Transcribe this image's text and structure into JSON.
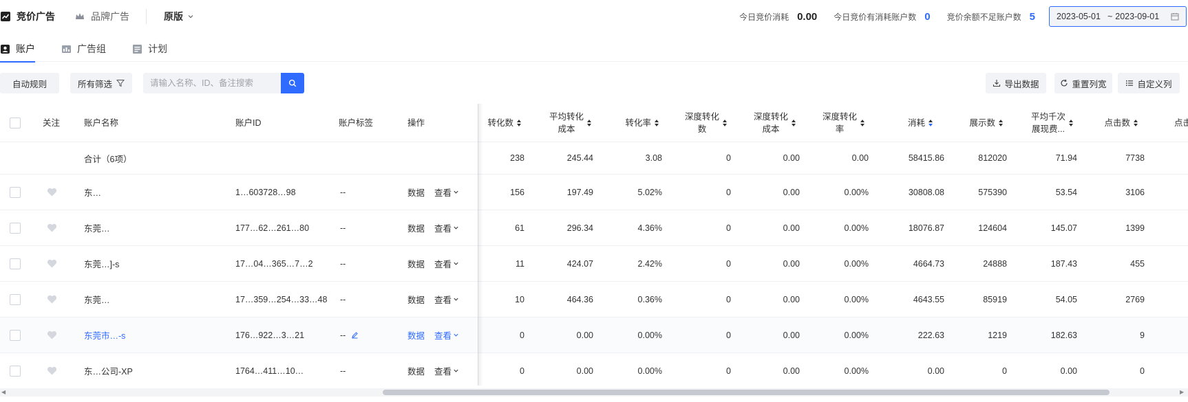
{
  "topbar": {
    "nav": [
      {
        "label": "竞价广告",
        "icon": "trend-chart-icon",
        "active": true
      },
      {
        "label": "品牌广告",
        "icon": "crown-icon",
        "active": false
      }
    ],
    "version": "原版",
    "stats": [
      {
        "label": "今日竞价消耗",
        "value": "0.00",
        "color": "#222222"
      },
      {
        "label": "今日竞价有消耗账户数",
        "value": "0",
        "color": "#2f6bff"
      },
      {
        "label": "竞价余额不足账户数",
        "value": "5",
        "color": "#2f6bff"
      }
    ],
    "date_start": "2023-05-01",
    "date_sep": "~",
    "date_end": "2023-09-01"
  },
  "tabs": [
    {
      "label": "账户",
      "icon": "account-icon",
      "active": true
    },
    {
      "label": "广告组",
      "icon": "ad-group-icon",
      "active": false
    },
    {
      "label": "计划",
      "icon": "plan-icon",
      "active": false
    }
  ],
  "toolbar": {
    "auto_rule": "自动规则",
    "all_filter": "所有筛选",
    "search_placeholder": "请输入名称、ID、备注搜索",
    "export": "导出数据",
    "reset_width": "重置列宽",
    "custom_columns": "自定义列"
  },
  "table": {
    "headers": {
      "follow": "关注",
      "name": "账户名称",
      "id": "账户ID",
      "tag": "账户标签",
      "ops": "操作",
      "conv": "转化数",
      "avg_cost_1": "平均转化",
      "avg_cost_2": "成本",
      "conv_rate": "转化率",
      "deep_conv_1": "深度转化",
      "deep_conv_2": "数",
      "deep_cost_1": "深度转化",
      "deep_cost_2": "成本",
      "deep_rate_1": "深度转化",
      "deep_rate_2": "率",
      "cost": "消耗",
      "impressions": "展示数",
      "cpm_1": "平均千次",
      "cpm_2": "展现费...",
      "clicks": "点击数",
      "next": "点击"
    },
    "total": {
      "label": "合计（6项）",
      "conv": "238",
      "avg_cost": "245.44",
      "conv_rate": "3.08",
      "deep_conv": "0",
      "deep_cost": "0.00",
      "deep_rate": "0.00",
      "cost": "58415.86",
      "impressions": "812020",
      "cpm": "71.94",
      "clicks": "7738"
    },
    "op_data": "数据",
    "op_view": "查看",
    "rows": [
      {
        "name": "东…",
        "id": "1…603728…98",
        "tag": "--",
        "conv": "156",
        "avg_cost": "197.49",
        "conv_rate": "5.02%",
        "deep_conv": "0",
        "deep_cost": "0.00",
        "deep_rate": "0.00%",
        "cost": "30808.08",
        "impressions": "575390",
        "cpm": "53.54",
        "clicks": "3106"
      },
      {
        "name": "东莞…",
        "id": "177…62…261…80",
        "tag": "--",
        "conv": "61",
        "avg_cost": "296.34",
        "conv_rate": "4.36%",
        "deep_conv": "0",
        "deep_cost": "0.00",
        "deep_rate": "0.00%",
        "cost": "18076.87",
        "impressions": "124604",
        "cpm": "145.07",
        "clicks": "1399"
      },
      {
        "name": "东莞…]-s",
        "id": "17…04…365…7…2",
        "tag": "--",
        "conv": "11",
        "avg_cost": "424.07",
        "conv_rate": "2.42%",
        "deep_conv": "0",
        "deep_cost": "0.00",
        "deep_rate": "0.00%",
        "cost": "4664.73",
        "impressions": "24888",
        "cpm": "187.43",
        "clicks": "455"
      },
      {
        "name": "东莞…",
        "id": "17…359…254…33…48",
        "tag": "--",
        "conv": "10",
        "avg_cost": "464.36",
        "conv_rate": "0.36%",
        "deep_conv": "0",
        "deep_cost": "0.00",
        "deep_rate": "0.00%",
        "cost": "4643.55",
        "impressions": "85919",
        "cpm": "54.05",
        "clicks": "2769"
      },
      {
        "name": "东莞市…-s",
        "id": "176…922…3…21",
        "tag": "--",
        "conv": "0",
        "avg_cost": "0.00",
        "conv_rate": "0.00%",
        "deep_conv": "0",
        "deep_cost": "0.00",
        "deep_rate": "0.00%",
        "cost": "222.63",
        "impressions": "1219",
        "cpm": "182.63",
        "clicks": "9"
      },
      {
        "name": "东…公司-XP",
        "id": "1764…411…10…",
        "tag": "--",
        "conv": "0",
        "avg_cost": "0.00",
        "conv_rate": "0.00%",
        "deep_conv": "0",
        "deep_cost": "0.00",
        "deep_rate": "0.00%",
        "cost": "0.00",
        "impressions": "0",
        "cpm": "0.00",
        "clicks": "0"
      }
    ]
  },
  "colors": {
    "accent": "#2f6bff",
    "border": "#eef0f4"
  }
}
